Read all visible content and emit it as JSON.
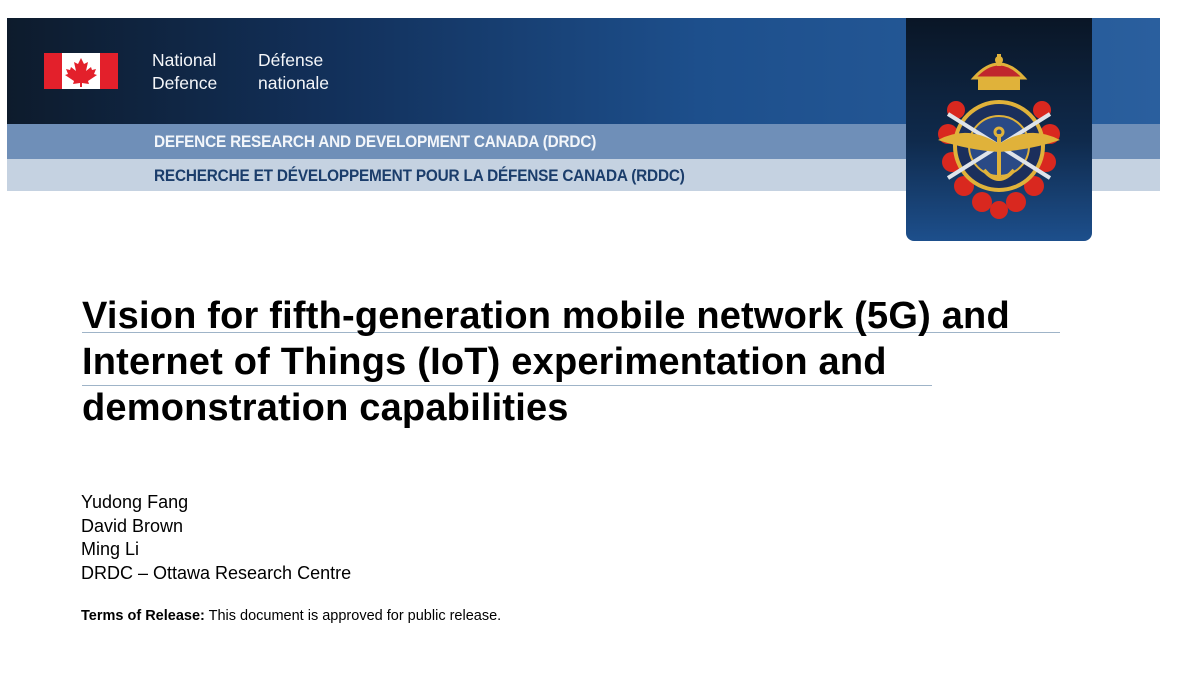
{
  "header": {
    "gov_en": [
      "National",
      "Defence"
    ],
    "gov_fr": [
      "Défense",
      "nationale"
    ],
    "org_en": "DEFENCE RESEARCH AND DEVELOPMENT CANADA (DRDC)",
    "org_fr": "RECHERCHE ET DÉVELOPPEMENT POUR LA DÉFENSE CANADA (RDDC)"
  },
  "title_lines": [
    "Vision for fifth-generation mobile network (5G) and",
    "Internet of Things (IoT) experimentation and",
    "demonstration capabilities"
  ],
  "authors": [
    "Yudong Fang",
    "David Brown",
    "Ming Li",
    "DRDC – Ottawa Research Centre"
  ],
  "release": {
    "label": "Terms of Release:",
    "text": " This document is approved for public release."
  },
  "colors": {
    "banner_dark": "#0d1b2c",
    "strip_en": "#6f8fb8",
    "strip_fr": "#c5d2e1",
    "flag_red": "#e3202b"
  }
}
